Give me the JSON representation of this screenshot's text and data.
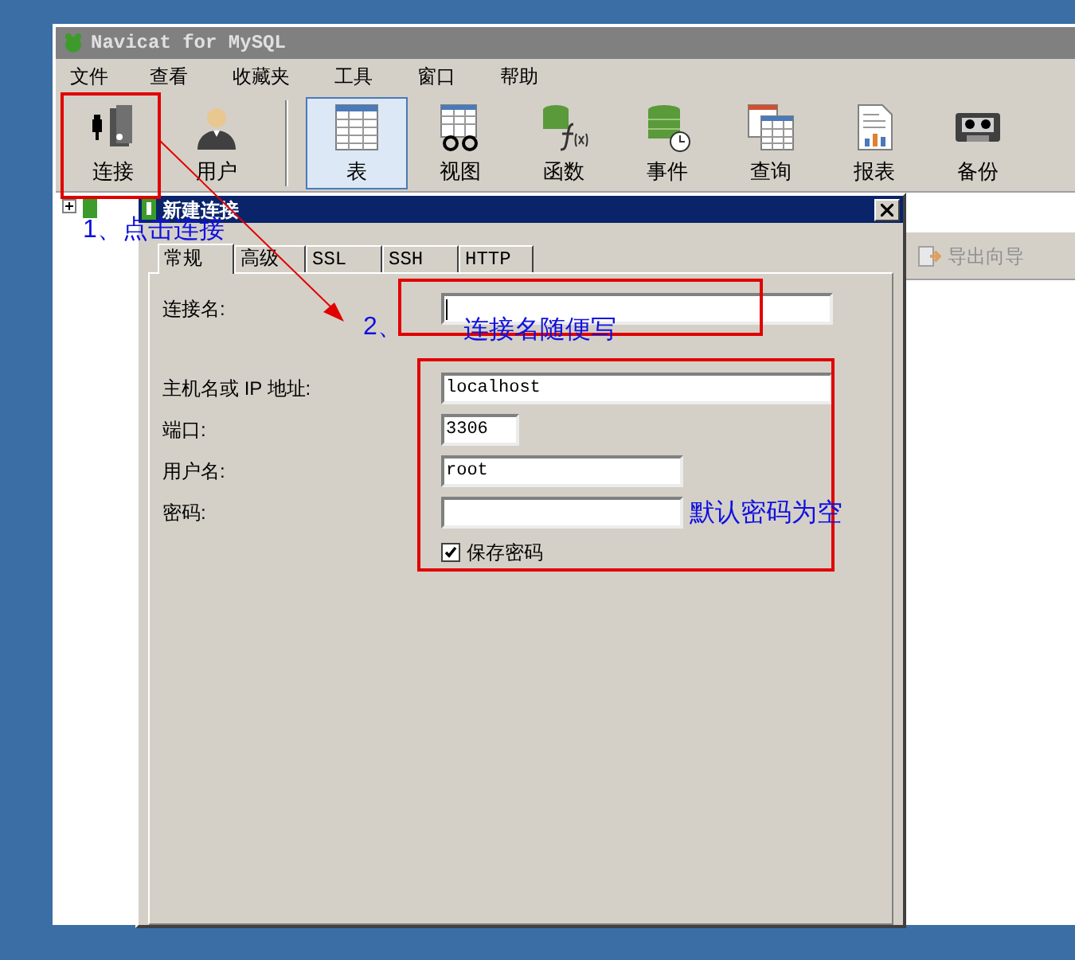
{
  "window": {
    "title": "Navicat for MySQL"
  },
  "menu": [
    "文件",
    "查看",
    "收藏夹",
    "工具",
    "窗口",
    "帮助"
  ],
  "toolbar": [
    {
      "label": "连接",
      "kind": "connect",
      "selected": false
    },
    {
      "label": "用户",
      "kind": "user",
      "selected": false
    },
    {
      "label": "表",
      "kind": "table",
      "selected": true
    },
    {
      "label": "视图",
      "kind": "view",
      "selected": false
    },
    {
      "label": "函数",
      "kind": "function",
      "selected": false
    },
    {
      "label": "事件",
      "kind": "event",
      "selected": false
    },
    {
      "label": "查询",
      "kind": "query",
      "selected": false
    },
    {
      "label": "报表",
      "kind": "report",
      "selected": false
    },
    {
      "label": "备份",
      "kind": "backup",
      "selected": false
    }
  ],
  "side_toolbar": {
    "label": "导出向导"
  },
  "dialog": {
    "title": "新建连接",
    "tabs": [
      {
        "label": "常规",
        "selected": true
      },
      {
        "label": "高级",
        "selected": false
      },
      {
        "label": "SSL",
        "selected": false
      },
      {
        "label": "SSH",
        "selected": false
      },
      {
        "label": "HTTP",
        "selected": false
      }
    ],
    "fields": [
      {
        "label": "连接名:",
        "kind": "long",
        "focused": true
      },
      {
        "label": "主机名或 IP 地址:",
        "value": "localhost",
        "kind": "long"
      },
      {
        "label": "端口:",
        "value": "3306",
        "kind": "short"
      },
      {
        "label": "用户名:",
        "value": "root",
        "kind": "medium"
      },
      {
        "label": "密码:",
        "kind": "medium"
      }
    ],
    "save_password": {
      "label": "保存密码",
      "checked": true
    }
  },
  "annotations": [
    {
      "text": "1、点击连接"
    },
    {
      "text": "2、"
    },
    {
      "text": "连接名随便写"
    },
    {
      "text": "默认密码为空"
    }
  ]
}
